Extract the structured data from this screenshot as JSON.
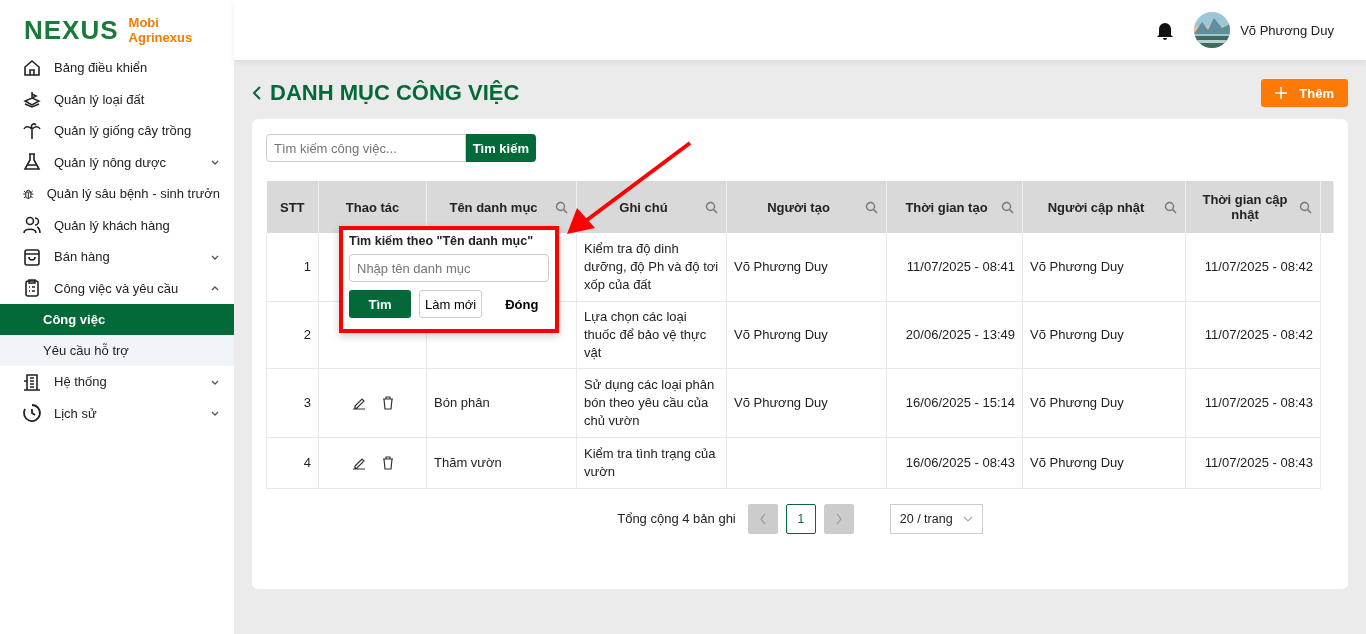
{
  "brand": {
    "logo_text": "NEXUS",
    "name_line1": "Mobi",
    "name_line2": "Agrinexus"
  },
  "sidebar": {
    "items": [
      {
        "label": "Bảng điều khiển",
        "kind": "home",
        "expandable": false
      },
      {
        "label": "Quản lý loại đất",
        "kind": "soil",
        "expandable": false
      },
      {
        "label": "Quản lý giống cây trồng",
        "kind": "plant",
        "expandable": false
      },
      {
        "label": "Quản lý nông dược",
        "kind": "flask",
        "expandable": true,
        "expanded": false
      },
      {
        "label": "Quản lý sâu bệnh - sinh trưởn",
        "kind": "bug",
        "expandable": false
      },
      {
        "label": "Quản lý khách hàng",
        "kind": "users",
        "expandable": false
      },
      {
        "label": "Bán hàng",
        "kind": "bag",
        "expandable": true,
        "expanded": false
      },
      {
        "label": "Công việc và yêu cầu",
        "kind": "clipboard",
        "expandable": true,
        "expanded": true,
        "children": [
          {
            "label": "Công việc",
            "selected": true
          },
          {
            "label": "Yêu cầu hỗ trợ",
            "selected": false
          }
        ]
      },
      {
        "label": "Hệ thống",
        "kind": "building",
        "expandable": true,
        "expanded": false
      },
      {
        "label": "Lịch sử",
        "kind": "history",
        "expandable": true,
        "expanded": false
      }
    ]
  },
  "header": {
    "user_name": "Võ Phương Duy"
  },
  "page": {
    "title": "DANH MỤC CÔNG VIỆC",
    "add_button": "Thêm"
  },
  "search": {
    "placeholder": "Tìm kiếm công việc...",
    "button": "Tìm kiếm"
  },
  "table": {
    "columns": [
      {
        "label": "STT",
        "searchable": false
      },
      {
        "label": "Thao tác",
        "searchable": false
      },
      {
        "label": "Tên danh mục",
        "searchable": true
      },
      {
        "label": "Ghi chú",
        "searchable": true
      },
      {
        "label": "Người tạo",
        "searchable": true
      },
      {
        "label": "Thời gian tạo",
        "searchable": true
      },
      {
        "label": "Người cập nhật",
        "searchable": true
      },
      {
        "label": "Thời gian cập nhật",
        "searchable": true
      }
    ],
    "rows": [
      {
        "stt": "1",
        "note": "Kiểm tra độ dinh dưỡng, độ Ph và độ tơi xốp của đất",
        "creator": "Võ Phương Duy",
        "created": "11/07/2025 - 08:41",
        "updater": "Võ Phương Duy",
        "updated": "11/07/2025 - 08:42"
      },
      {
        "stt": "2",
        "note": "Lựa chọn các loại thuốc để bảo vệ thực vật",
        "creator": "Võ Phương Duy",
        "created": "20/06/2025 - 13:49",
        "updater": "Võ Phương Duy",
        "updated": "11/07/2025 - 08:42"
      },
      {
        "stt": "3",
        "name": "Bón phân",
        "note": "Sử dụng các loại phân bón theo yêu cầu của chủ vườn",
        "creator": "Võ Phương Duy",
        "created": "16/06/2025 - 15:14",
        "updater": "Võ Phương Duy",
        "updated": "11/07/2025 - 08:43"
      },
      {
        "stt": "4",
        "name": "Thăm vườn",
        "note": "Kiểm tra tình trạng của vườn",
        "created": "16/06/2025 - 08:43",
        "updater": "Võ Phương Duy",
        "updated": "11/07/2025 - 08:43"
      }
    ]
  },
  "pagination": {
    "total": "Tổng cộng 4 bản ghi",
    "pages": [
      {
        "label": "1",
        "selected": true
      }
    ],
    "page_size": "20 / trang"
  },
  "filter_popup": {
    "title": "Tìm kiếm theo \"Tên danh mục\"",
    "placeholder": "Nhập tên danh mục",
    "search_button": "Tìm",
    "reset_button": "Làm mới",
    "close_button": "Đóng"
  }
}
